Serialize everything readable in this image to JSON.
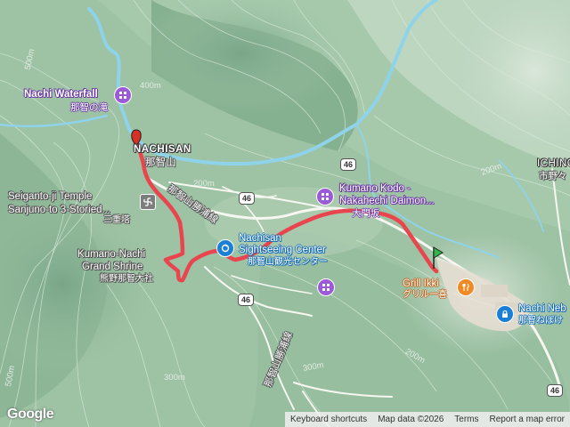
{
  "places": {
    "nachi_waterfall": "Nachi Waterfall",
    "nachi_waterfall_jp": "那智の滝",
    "nachisan": "NACHISAN",
    "nachisan_jp": "那智山",
    "seiganto_1": "Seiganto-ji Temple",
    "seiganto_2": "Sanjuno-to 3-Storied...",
    "sanjuno_jp": "三重塔",
    "grand_shrine_1": "Kumano-Nachi",
    "grand_shrine_2": "Grand Shrine",
    "grand_shrine_jp": "熊野那智大社",
    "sightseeing_1": "Nachisan",
    "sightseeing_2": "Sightseeing Center",
    "sightseeing_jp": "那智山観光センター",
    "kumano_kodo_1": "Kumano Kodo -",
    "kumano_kodo_2": "Nakahechi Daimon...",
    "kumano_kodo_jp": "大門坂",
    "grill": "Grill Ikki",
    "grill_jp": "グリル一喜",
    "nachi_neb": "Nachi Neb",
    "nachi_neb_jp": "那智ねぼけ",
    "ichino": "ICHINO",
    "ichino_jp": "市野々",
    "road_nachisan_1": "那智山勝浦線",
    "road_nachisan_2": "那智山勝浦線"
  },
  "roads": {
    "route_46_a": "46",
    "route_46_b": "46",
    "route_46_c": "46",
    "route_46_d": "46"
  },
  "contours": {
    "c1": "500m",
    "c2": "400m",
    "c3": "200m",
    "c4": "300m",
    "c5": "500m",
    "c6": "200m",
    "c7": "300m",
    "c8": "200m"
  },
  "footer": {
    "shortcuts": "Keyboard shortcuts",
    "map_data": "Map data ©2026",
    "terms": "Terms",
    "report": "Report a map error"
  },
  "logo": "Google",
  "colors": {
    "track": "#e8454f",
    "start_pin": "#2eb84a",
    "end_pin": "#d93025",
    "poi": "#9c5bd6",
    "water": "#8fd3ea"
  },
  "icons": {
    "start": "green-flag-icon",
    "end": "red-pin-icon",
    "poi": "poi-marker-icon",
    "restaurant": "fork-knife-icon",
    "parking": "lock-icon",
    "temple": "manji-icon"
  }
}
